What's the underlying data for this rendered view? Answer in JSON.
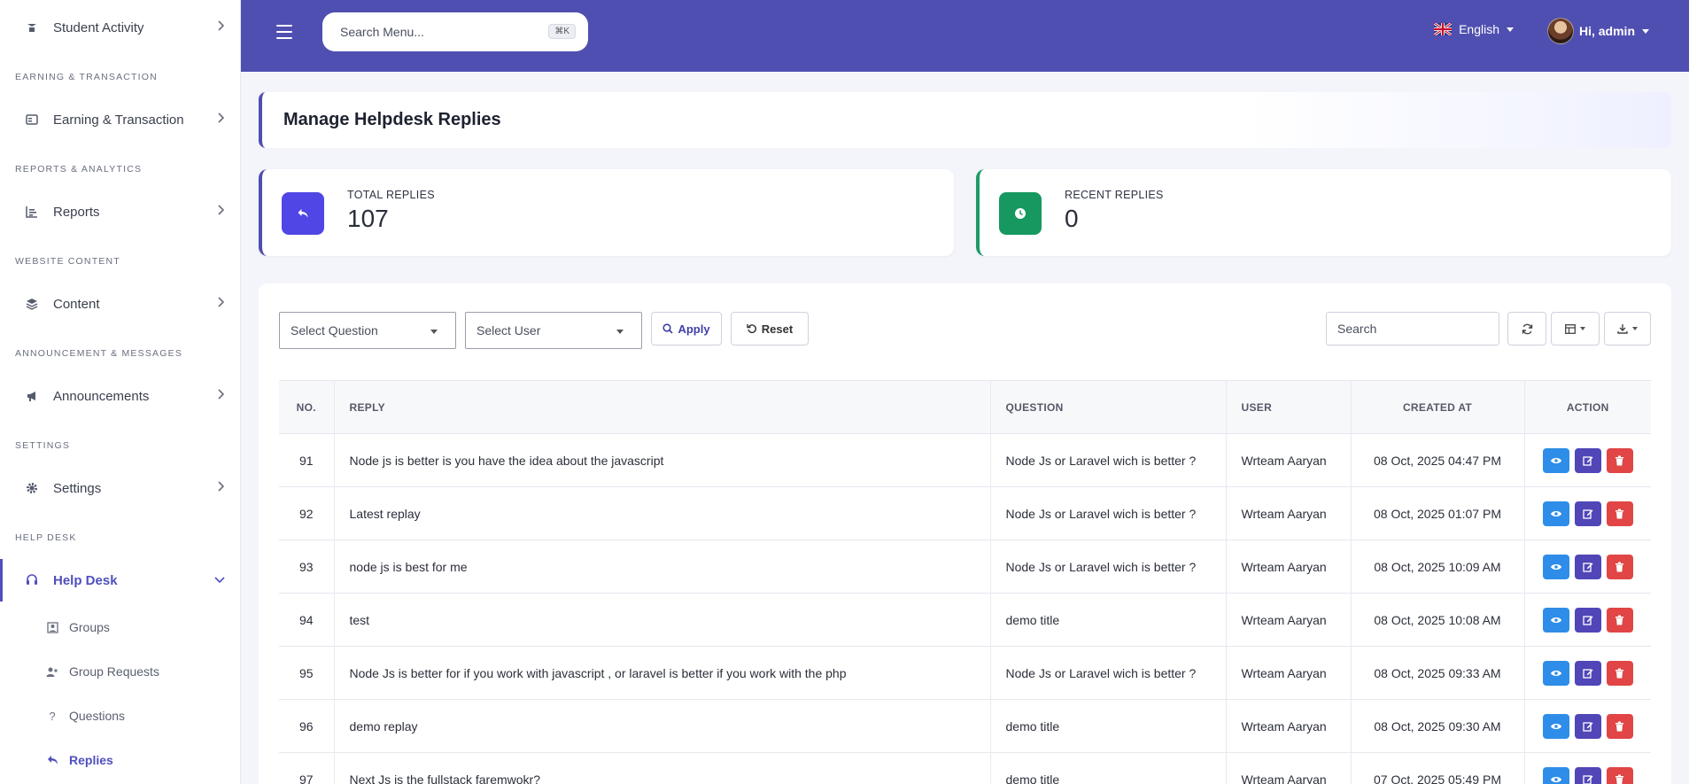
{
  "sidebar": {
    "items": [
      {
        "label": "Student Activity"
      },
      {
        "label": "Earning & Transaction"
      },
      {
        "label": "Reports"
      },
      {
        "label": "Content"
      },
      {
        "label": "Announcements"
      },
      {
        "label": "Settings"
      },
      {
        "label": "Help Desk"
      }
    ],
    "sections": [
      "EARNING & TRANSACTION",
      "REPORTS & ANALYTICS",
      "WEBSITE CONTENT",
      "ANNOUNCEMENT & MESSAGES",
      "SETTINGS",
      "HELP DESK"
    ],
    "subitems": [
      {
        "label": "Groups"
      },
      {
        "label": "Group Requests"
      },
      {
        "label": "Questions"
      },
      {
        "label": "Replies"
      }
    ]
  },
  "topbar": {
    "search_placeholder": "Search Menu...",
    "shortcut": "⌘K",
    "language": "English",
    "user_greeting": "Hi, admin"
  },
  "page": {
    "title": "Manage Helpdesk Replies"
  },
  "stats": [
    {
      "label": "TOTAL REPLIES",
      "value": "107"
    },
    {
      "label": "RECENT REPLIES",
      "value": "0"
    }
  ],
  "filters": {
    "question_select": "Select Question",
    "user_select": "Select User",
    "apply": "Apply",
    "reset": "Reset",
    "search_placeholder": "Search"
  },
  "table": {
    "headers": [
      "NO.",
      "REPLY",
      "QUESTION",
      "USER",
      "CREATED AT",
      "ACTION"
    ],
    "rows": [
      {
        "no": "91",
        "reply": "Node js is better is you have the idea about the javascript",
        "question": "Node Js or Laravel wich is better ?",
        "user": "Wrteam Aaryan",
        "created": "08 Oct, 2025 04:47 PM"
      },
      {
        "no": "92",
        "reply": "Latest replay",
        "question": "Node Js or Laravel wich is better ?",
        "user": "Wrteam Aaryan",
        "created": "08 Oct, 2025 01:07 PM"
      },
      {
        "no": "93",
        "reply": "node js is best for me",
        "question": "Node Js or Laravel wich is better ?",
        "user": "Wrteam Aaryan",
        "created": "08 Oct, 2025 10:09 AM"
      },
      {
        "no": "94",
        "reply": "test",
        "question": "demo title",
        "user": "Wrteam Aaryan",
        "created": "08 Oct, 2025 10:08 AM"
      },
      {
        "no": "95",
        "reply": "Node Js is better for if you work with javascript , or laravel is better if you work with the php",
        "question": "Node Js or Laravel wich is better ?",
        "user": "Wrteam Aaryan",
        "created": "08 Oct, 2025 09:33 AM"
      },
      {
        "no": "96",
        "reply": "demo replay",
        "question": "demo title",
        "user": "Wrteam Aaryan",
        "created": "08 Oct, 2025 09:30 AM"
      },
      {
        "no": "97",
        "reply": "Next Js is the fullstack faremwokr?",
        "question": "demo title",
        "user": "Wrteam Aaryan",
        "created": "07 Oct, 2025 05:49 PM"
      }
    ]
  },
  "colors": {
    "primary": "#4f4fb1",
    "success": "#169860",
    "view": "#2e8de8",
    "edit": "#5046b8",
    "delete": "#e14545"
  }
}
